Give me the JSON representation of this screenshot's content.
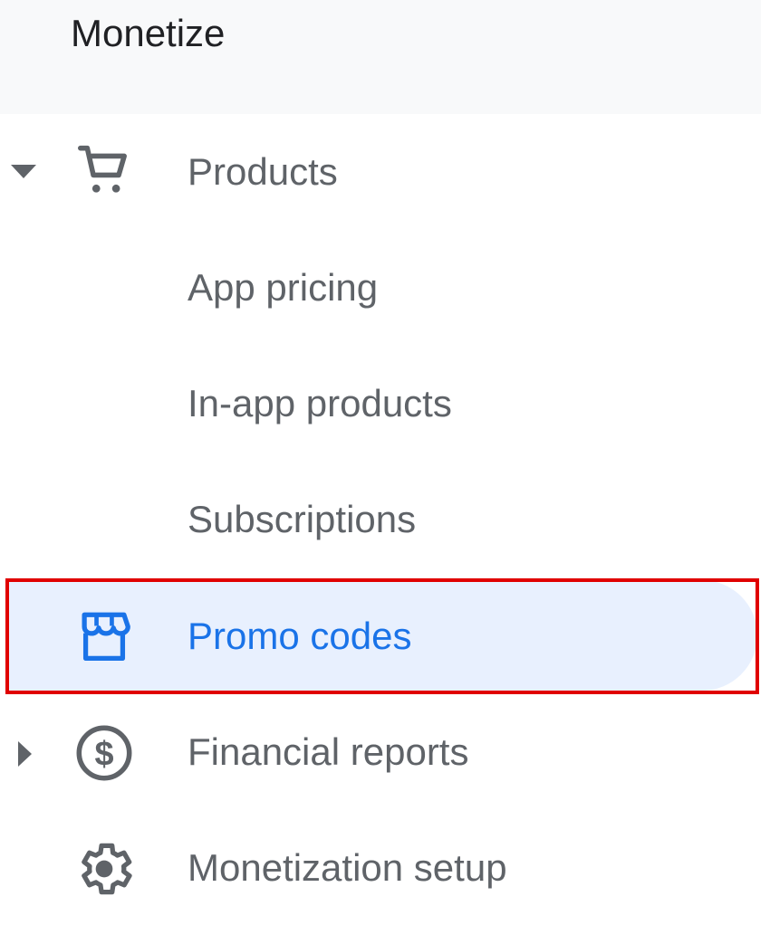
{
  "section": {
    "title": "Monetize"
  },
  "nav": {
    "products": {
      "label": "Products",
      "icon": "shopping-cart-icon",
      "expanded": true
    },
    "app_pricing": {
      "label": "App pricing"
    },
    "in_app_products": {
      "label": "In-app products"
    },
    "subscriptions": {
      "label": "Subscriptions"
    },
    "promo_codes": {
      "label": "Promo codes",
      "icon": "storefront-icon",
      "active": true
    },
    "financial_reports": {
      "label": "Financial reports",
      "icon": "dollar-circle-icon",
      "expanded": false
    },
    "monetization_setup": {
      "label": "Monetization setup",
      "icon": "gear-icon"
    }
  },
  "colors": {
    "text_default": "#5f6368",
    "text_active": "#1a73e8",
    "active_background": "#e8f0fe",
    "highlight_border": "#e00000",
    "header_background": "#f8f9fa"
  }
}
